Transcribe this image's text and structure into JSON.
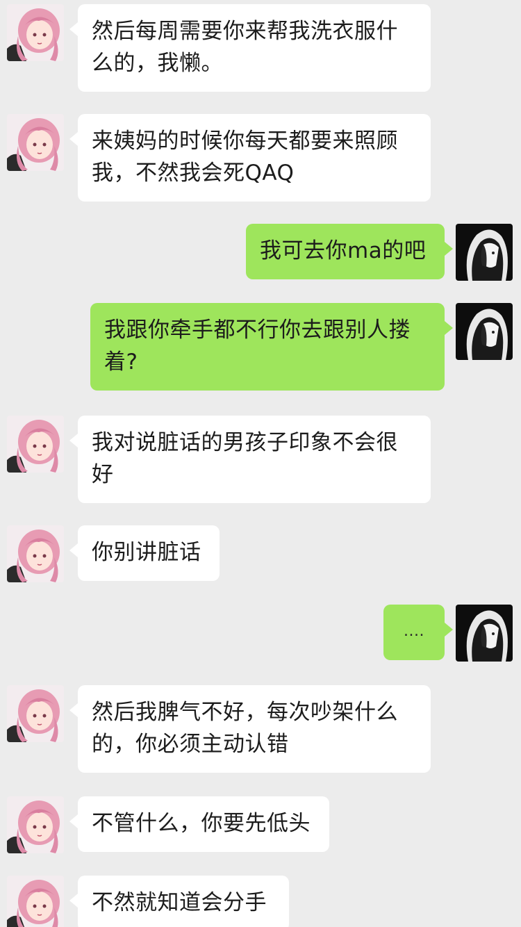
{
  "messages": [
    {
      "side": "left",
      "text": "然后每周需要你来帮我洗衣服什么的，我懒。"
    },
    {
      "side": "left",
      "text": "来姨妈的时候你每天都要来照顾我，不然我会死QAQ"
    },
    {
      "side": "right",
      "text": "我可去你ma的吧"
    },
    {
      "side": "right",
      "text": "我跟你牵手都不行你去跟别人搂着?"
    },
    {
      "side": "left",
      "text": "我对说脏话的男孩子印象不会很好"
    },
    {
      "side": "left",
      "text": "你别讲脏话"
    },
    {
      "side": "right",
      "text": "...."
    },
    {
      "side": "left",
      "text": "然后我脾气不好，每次吵架什么的，你必须主动认错"
    },
    {
      "side": "left",
      "text": "不管什么，你要先低头"
    },
    {
      "side": "left",
      "text": "不然就知道会分手"
    }
  ],
  "colors": {
    "background": "#ececec",
    "incoming_bubble": "#ffffff",
    "outgoing_bubble": "#9ee55c"
  },
  "avatars": {
    "incoming": "pink-hair-anime-girl-avatar",
    "outgoing": "dark-hooded-anime-avatar"
  }
}
